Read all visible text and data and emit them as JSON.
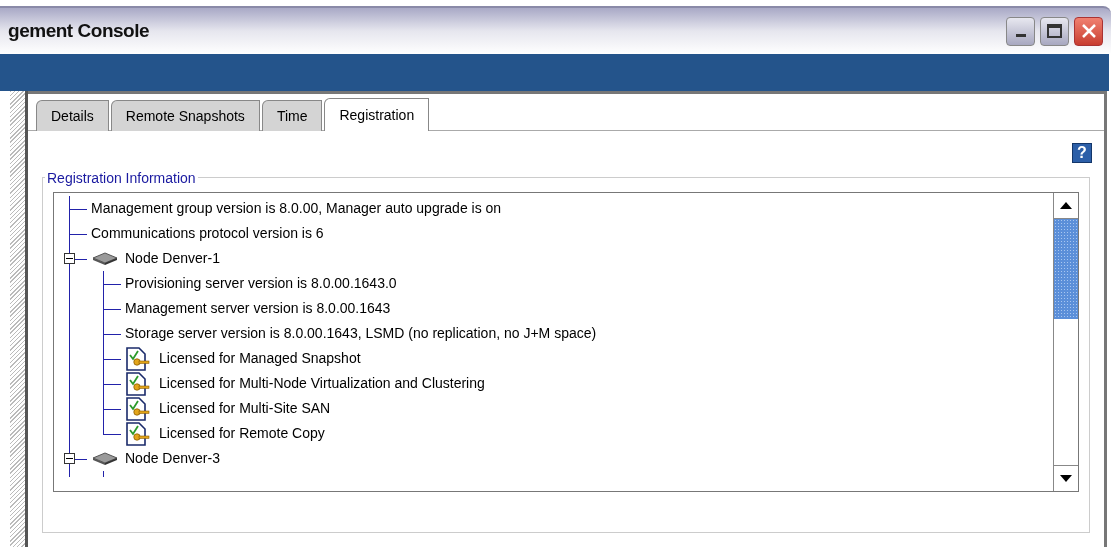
{
  "window": {
    "title": "gement Console"
  },
  "tabs": [
    {
      "label": "Details",
      "selected": false
    },
    {
      "label": "Remote Snapshots",
      "selected": false
    },
    {
      "label": "Time",
      "selected": false
    },
    {
      "label": "Registration",
      "selected": true
    }
  ],
  "help_button": {
    "label": "?"
  },
  "group": {
    "title": "Registration Information"
  },
  "tree": [
    {
      "kind": "text",
      "label": "Management group version is 8.0.00, Manager auto upgrade is on"
    },
    {
      "kind": "text",
      "label": "Communications protocol version is 6"
    },
    {
      "kind": "node",
      "label": "Node Denver-1",
      "expanded": true,
      "children": [
        {
          "kind": "text",
          "label": "Provisioning server version is 8.0.00.1643.0"
        },
        {
          "kind": "text",
          "label": "Management server version is 8.0.00.1643"
        },
        {
          "kind": "text",
          "label": "Storage server version is 8.0.00.1643, LSMD (no replication, no J+M space)"
        },
        {
          "kind": "license",
          "label": "Licensed for Managed Snapshot"
        },
        {
          "kind": "license",
          "label": "Licensed for Multi-Node Virtualization and Clustering"
        },
        {
          "kind": "license",
          "label": "Licensed for Multi-Site SAN"
        },
        {
          "kind": "license",
          "label": "Licensed for Remote Copy"
        }
      ]
    },
    {
      "kind": "node",
      "label": "Node Denver-3",
      "expanded": true
    }
  ]
}
